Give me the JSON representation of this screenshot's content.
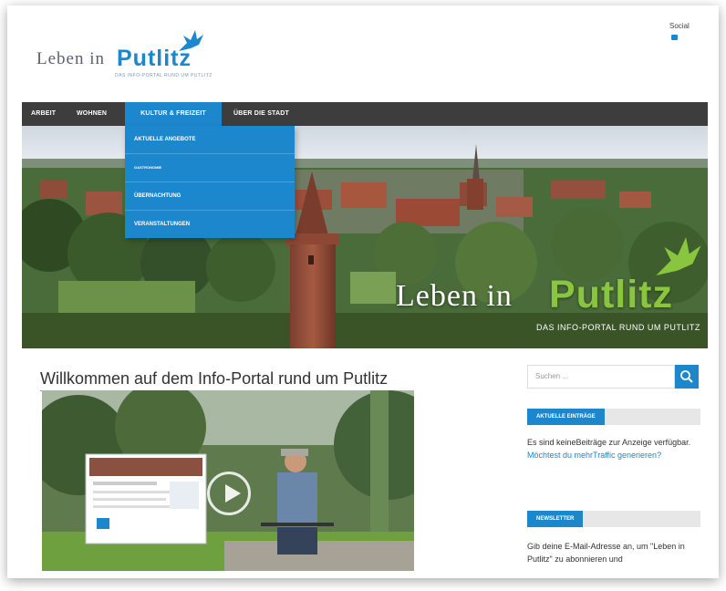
{
  "header": {
    "logo_word1": "Leben in",
    "logo_word2": "Putlitz",
    "logo_tagline": "DAS INFO-PORTAL RUND UM PUTLITZ",
    "social_label": "Social"
  },
  "nav": {
    "items": [
      "ARBEIT",
      "WOHNEN",
      "KULTUR & FREIZEIT",
      "ÜBER DIE STADT"
    ],
    "active_index": 2,
    "dropdown": [
      "AKTUELLE ANGEBOTE",
      "GASTRONOMIE",
      "ÜBERNACHTUNG",
      "VERANSTALTUNGEN"
    ]
  },
  "hero": {
    "logo_word1": "Leben in",
    "logo_word2": "Putlitz",
    "logo_tagline": "DAS INFO-PORTAL RUND UM PUTLITZ"
  },
  "main": {
    "title": "Willkommen auf dem Info-Portal rund um Putlitz"
  },
  "sidebar": {
    "search_placeholder": "Suchen ...",
    "widget1_title": "AKTUELLE EINTRÄGE",
    "widget1_text": "Es sind keineBeiträge zur Anzeige verfügbar.",
    "widget1_link": "Möchtest du mehrTraffic generieren?",
    "widget2_title": "NEWSLETTER",
    "widget2_text": "Gib deine E-Mail-Adresse an, um \"Leben in Putlitz\" zu abonnieren und"
  },
  "colors": {
    "accent": "#1d87cd",
    "nav_bg": "#3d3d3d",
    "hero_green": "#8ac53f"
  },
  "icons": {
    "search": "search-icon",
    "play": "play-icon",
    "social": "facebook-icon",
    "logo": "heron-bird-icon"
  }
}
